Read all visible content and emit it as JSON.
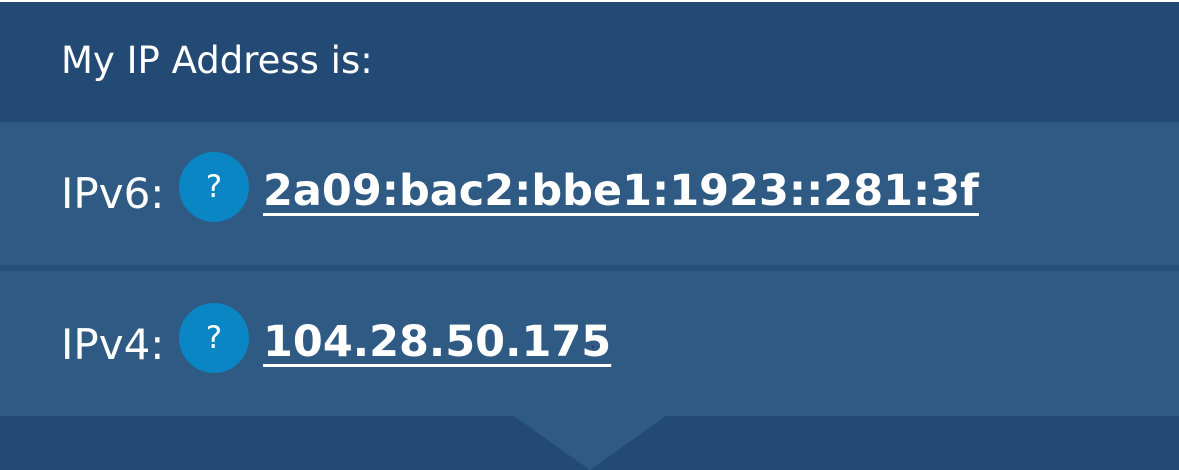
{
  "header": {
    "title": "My IP Address is:"
  },
  "rows": [
    {
      "label": "IPv6:",
      "help_text": "?",
      "value": "2a09:bac2:bbe1:1923::281:3f"
    },
    {
      "label": "IPv4:",
      "help_text": "?",
      "value": "104.28.50.175"
    }
  ],
  "colors": {
    "header_background": "#234a75",
    "row_background": "#2e5a83",
    "help_icon_background": "#0a86c4",
    "text": "#ffffff"
  },
  "icons": {
    "help": "question-mark-icon"
  }
}
